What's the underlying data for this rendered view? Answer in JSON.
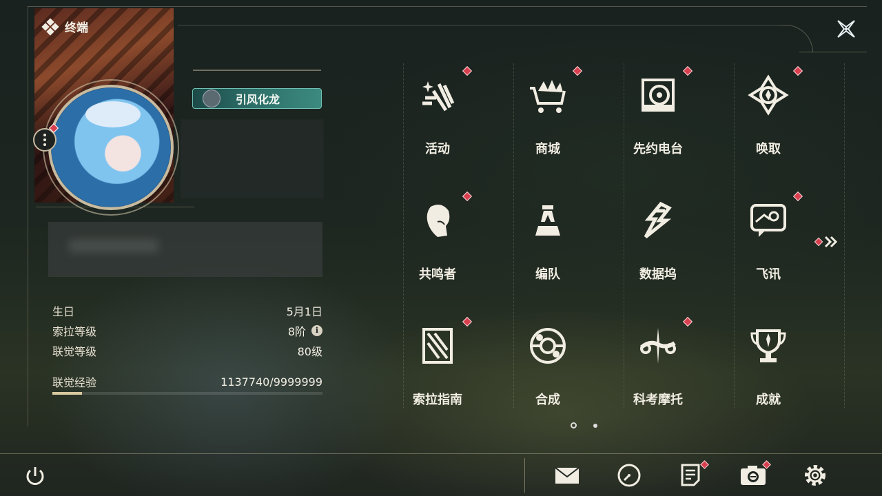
{
  "header": {
    "title": "终端"
  },
  "profile": {
    "title_badge": "引风化龙",
    "stats": [
      {
        "label": "生日",
        "value": "5月1日"
      },
      {
        "label": "索拉等级",
        "value": "8阶"
      },
      {
        "label": "联觉等级",
        "value": "80级"
      }
    ],
    "exp": {
      "label": "联觉经验",
      "value": "1137740/9999999",
      "progress": 0.11
    }
  },
  "menu": {
    "items": [
      {
        "label": "活动",
        "icon": "activity-icon",
        "badge": true
      },
      {
        "label": "商城",
        "icon": "shop-cart-icon",
        "badge": true
      },
      {
        "label": "先约电台",
        "icon": "radio-icon",
        "badge": true
      },
      {
        "label": "唤取",
        "icon": "convene-icon",
        "badge": true
      },
      {
        "label": "共鸣者",
        "icon": "resonator-icon",
        "badge": true
      },
      {
        "label": "编队",
        "icon": "team-chess-icon",
        "badge": false
      },
      {
        "label": "数据坞",
        "icon": "data-bank-icon",
        "badge": false
      },
      {
        "label": "飞讯",
        "icon": "message-icon",
        "badge": true
      },
      {
        "label": "索拉指南",
        "icon": "guide-icon",
        "badge": true
      },
      {
        "label": "合成",
        "icon": "synthesis-icon",
        "badge": false
      },
      {
        "label": "科考摩托",
        "icon": "motorbike-icon",
        "badge": true
      },
      {
        "label": "成就",
        "icon": "trophy-icon",
        "badge": false
      }
    ],
    "page": 1,
    "page_count": 2
  },
  "toolbar": {
    "buttons": [
      {
        "name": "mail",
        "icon": "mail-icon",
        "badge": false
      },
      {
        "name": "clock",
        "icon": "clock-icon",
        "badge": false
      },
      {
        "name": "notes",
        "icon": "notes-icon",
        "badge": true
      },
      {
        "name": "camera",
        "icon": "camera-icon",
        "badge": true
      },
      {
        "name": "settings",
        "icon": "gear-icon",
        "badge": false
      }
    ]
  },
  "colors": {
    "accent": "#d8404f",
    "text": "#f1ede2",
    "badge_teal": "#2c6e68"
  }
}
